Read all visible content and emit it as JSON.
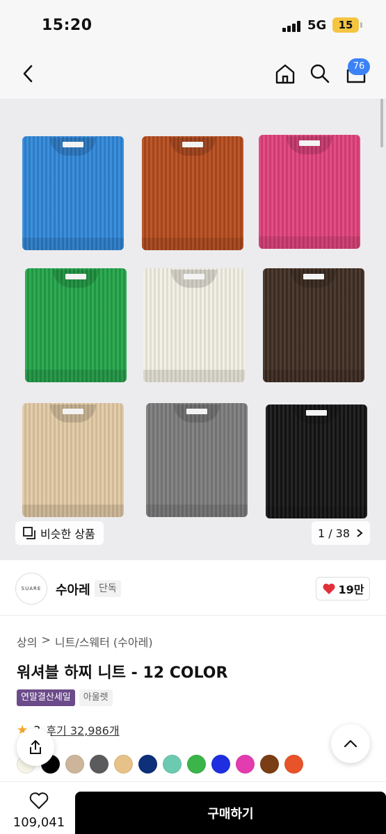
{
  "status": {
    "time": "15:20",
    "network": "5G",
    "battery": "15"
  },
  "nav": {
    "cart_badge": "76"
  },
  "hero": {
    "sweater_colors": [
      "#2f86d8",
      "#b44a1c",
      "#e0407a",
      "#22a348",
      "#f2efe3",
      "#3f2d22",
      "#e2c9a3",
      "#7b7b7b",
      "#141414"
    ],
    "similar_label": "비슷한 상품",
    "counter": "1 / 38"
  },
  "brand": {
    "logo_text": "SUARE",
    "name": "수아레",
    "tag": "단독",
    "likes": "19만"
  },
  "breadcrumb": [
    "상의",
    ">",
    "니트/스웨터 (수아레)"
  ],
  "product": {
    "title": "워셔블 하찌 니트 - 12 COLOR",
    "badge_sale": "연말결산세일",
    "badge_outlet": "아울렛"
  },
  "rating": {
    "score": "3",
    "reviews": "후기 32,986개"
  },
  "swatches": [
    "#f6f4e6",
    "#000000",
    "#cdb59b",
    "#5b5b5e",
    "#e6c288",
    "#0e2f7a",
    "#6ccab1",
    "#3bb54a",
    "#1f2fe0",
    "#e33bb0",
    "#7a3d14",
    "#e8532a"
  ],
  "bottom": {
    "wish_count": "109,041",
    "buy_label": "구매하기"
  }
}
